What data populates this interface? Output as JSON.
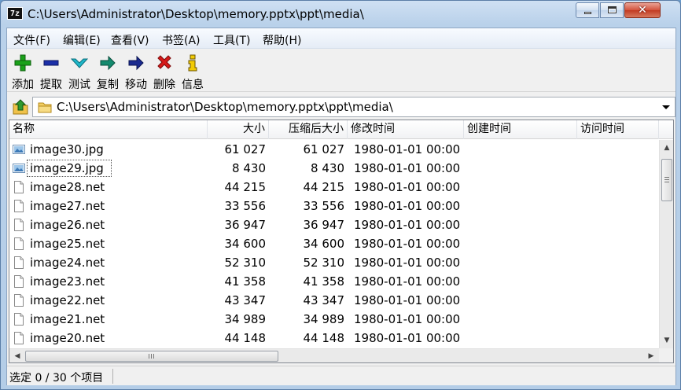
{
  "window": {
    "app_icon": "7z",
    "title": "C:\\Users\\Administrator\\Desktop\\memory.pptx\\ppt\\media\\"
  },
  "menu": [
    {
      "label": "文件(F)"
    },
    {
      "label": "编辑(E)"
    },
    {
      "label": "查看(V)"
    },
    {
      "label": "书签(A)"
    },
    {
      "label": "工具(T)"
    },
    {
      "label": "帮助(H)"
    }
  ],
  "toolbar": {
    "add": {
      "label": "添加",
      "icon": "plus-icon",
      "color": "#1aa11a"
    },
    "extract": {
      "label": "提取",
      "icon": "minus-icon",
      "color": "#1b2fa8"
    },
    "test": {
      "label": "测试",
      "icon": "check-icon",
      "color": "#1fb7c9"
    },
    "copy": {
      "label": "复制",
      "icon": "copy-arrow-icon",
      "color": "#148a6e"
    },
    "move": {
      "label": "移动",
      "icon": "move-arrow-icon",
      "color": "#1a2a8f"
    },
    "delete": {
      "label": "删除",
      "icon": "delete-x-icon",
      "color": "#d61a1a"
    },
    "info": {
      "label": "信息",
      "icon": "info-icon",
      "color": "#c9a000"
    }
  },
  "address": {
    "path": "C:\\Users\\Administrator\\Desktop\\memory.pptx\\ppt\\media\\"
  },
  "columns": [
    {
      "label": "名称"
    },
    {
      "label": "大小"
    },
    {
      "label": "压缩后大小"
    },
    {
      "label": "修改时间"
    },
    {
      "label": "创建时间"
    },
    {
      "label": "访问时间"
    }
  ],
  "files": [
    {
      "name": "image30.jpg",
      "type": "image",
      "size": "61 027",
      "packed": "61 027",
      "modified": "1980-01-01 00:00"
    },
    {
      "name": "image29.jpg",
      "type": "image",
      "size": "8 430",
      "packed": "8 430",
      "modified": "1980-01-01 00:00"
    },
    {
      "name": "image28.net",
      "type": "file",
      "size": "44 215",
      "packed": "44 215",
      "modified": "1980-01-01 00:00"
    },
    {
      "name": "image27.net",
      "type": "file",
      "size": "33 556",
      "packed": "33 556",
      "modified": "1980-01-01 00:00"
    },
    {
      "name": "image26.net",
      "type": "file",
      "size": "36 947",
      "packed": "36 947",
      "modified": "1980-01-01 00:00"
    },
    {
      "name": "image25.net",
      "type": "file",
      "size": "34 600",
      "packed": "34 600",
      "modified": "1980-01-01 00:00"
    },
    {
      "name": "image24.net",
      "type": "file",
      "size": "52 310",
      "packed": "52 310",
      "modified": "1980-01-01 00:00"
    },
    {
      "name": "image23.net",
      "type": "file",
      "size": "41 358",
      "packed": "41 358",
      "modified": "1980-01-01 00:00"
    },
    {
      "name": "image22.net",
      "type": "file",
      "size": "43 347",
      "packed": "43 347",
      "modified": "1980-01-01 00:00"
    },
    {
      "name": "image21.net",
      "type": "file",
      "size": "34 989",
      "packed": "34 989",
      "modified": "1980-01-01 00:00"
    },
    {
      "name": "image20.net",
      "type": "file",
      "size": "44 148",
      "packed": "44 148",
      "modified": "1980-01-01 00:00"
    }
  ],
  "focused_row": 1,
  "status": {
    "text": "选定 0 / 30 个项目"
  }
}
